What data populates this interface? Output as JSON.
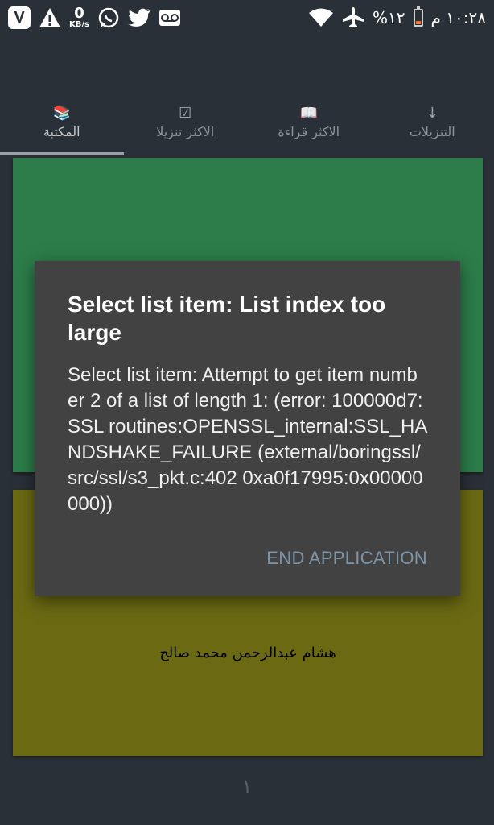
{
  "status_bar": {
    "left_icons": [
      "vivo-app-icon",
      "warning-icon",
      "data-rate",
      "whatsapp-icon",
      "twitter-icon",
      "voicemail-icon"
    ],
    "app_badge": "V",
    "data_rate": {
      "value": "0",
      "unit": "KB/s"
    },
    "battery": "%١٢",
    "time": "١٠:٢٨ م",
    "battery_level": 0.12,
    "battery_color": "#ff6f22"
  },
  "tabs": [
    {
      "label": "التنزيلات",
      "icon": "download-icon"
    },
    {
      "label": "الاكثر قراءة",
      "icon": "open-book-icon"
    },
    {
      "label": "الاكثر تنزيلا",
      "icon": "checkbox-icon"
    },
    {
      "label": "المكتبة",
      "icon": "books-icon",
      "active": true
    }
  ],
  "cards": [
    {
      "color": "#2c7d4a"
    },
    {
      "color": "#6b6a13",
      "author": "هشام عبدالرحمن محمد صالح"
    }
  ],
  "page_number": "١",
  "dialog": {
    "title": "Select list item: List index too large",
    "message": "Select list item: Attempt to get item number 2 of a list of length 1: (error: 100000d7:SSL routines:OPENSSL_internal:SSL_HANDSHAKE_FAILURE (external/boringssl/src/ssl/s3_pkt.c:402 0xa0f17995:0x00000000))",
    "action": "END APPLICATION"
  }
}
